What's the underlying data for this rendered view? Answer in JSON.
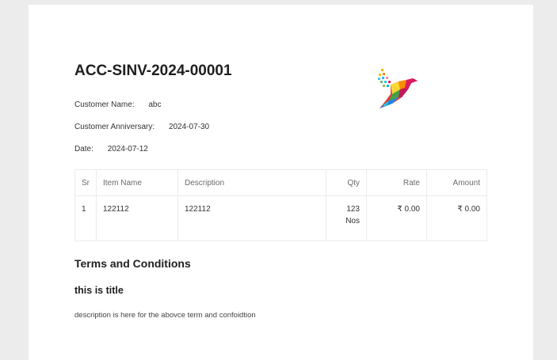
{
  "invoice": {
    "number": "ACC-SINV-2024-00001",
    "customer_name_label": "Customer Name:",
    "customer_name": "abc",
    "anniversary_label": "Customer Anniversary:",
    "anniversary": "2024-07-30",
    "date_label": "Date:",
    "date": "2024-07-12"
  },
  "logo": {
    "icon": "colorful-bird-logo-icon"
  },
  "items_table": {
    "headers": [
      "Sr",
      "Item Name",
      "Description",
      "Qty",
      "Rate",
      "Amount"
    ],
    "rows": [
      {
        "sr": "1",
        "item_name": "122112",
        "description": "122112",
        "qty": "123",
        "qty_unit": "Nos",
        "rate": "₹ 0.00",
        "amount": "₹ 0.00"
      }
    ]
  },
  "terms": {
    "heading": "Terms and Conditions",
    "title": "this is title",
    "description": "description is here for the abovce term and confoidtion"
  },
  "colors": {
    "page_bg": "#ececec",
    "sheet_bg": "#ffffff",
    "border": "#ececec"
  }
}
